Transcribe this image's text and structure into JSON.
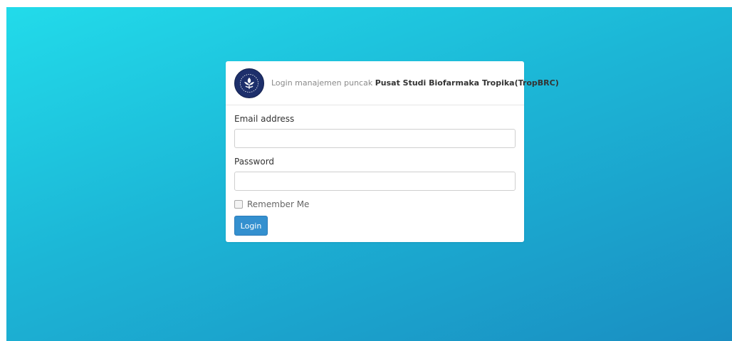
{
  "header": {
    "prefix": "Login manajemen puncak",
    "organization": "Pusat Studi Biofarmaka Tropika(TropBRC)",
    "logo_icon": "university-seal-icon"
  },
  "form": {
    "email_label": "Email address",
    "email_value": "",
    "password_label": "Password",
    "password_value": "",
    "remember_label": "Remember Me",
    "remember_checked": false,
    "login_label": "Login"
  },
  "colors": {
    "background_start": "#22dbea",
    "background_end": "#1a8ec2",
    "button": "#3490cf",
    "logo": "#1d2f6b"
  }
}
